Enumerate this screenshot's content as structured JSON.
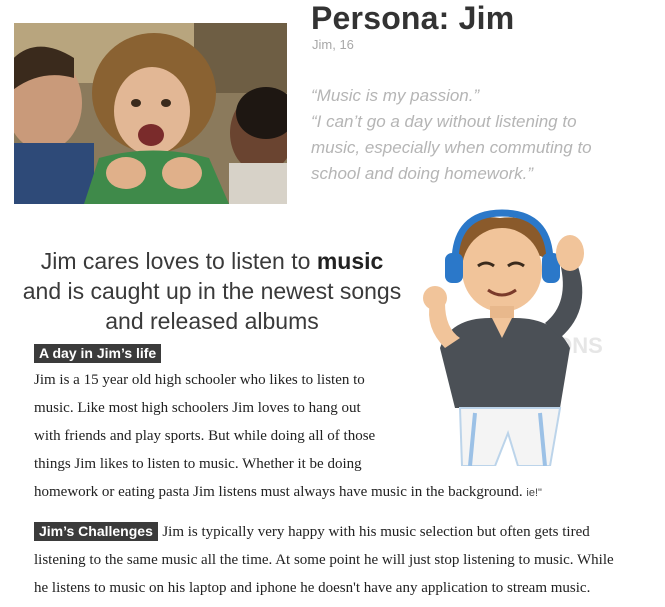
{
  "header": {
    "title": "Persona: Jim",
    "subtitle": "Jim, 16"
  },
  "quotes": [
    "“Music is my passion.”",
    "“I can’t go a day without listening to",
    "music, especially when commuting to",
    "school and doing homework.”"
  ],
  "headline": {
    "before": "Jim cares loves to listen to ",
    "bold": "music",
    "after": " and is caught up in the newest songs and released albums"
  },
  "day": {
    "label": "A day in Jim’s life",
    "lines": [
      "Jim is a 15 year old high schooler who likes to listen to",
      "music. Like most high schoolers Jim loves to hang out",
      "with friends and play sports. But while doing all of those",
      "things Jim likes to listen to music. Whether it be doing",
      "homework or eating pasta Jim listens must always have music in the background."
    ],
    "trailing": "ie!\""
  },
  "challenges": {
    "label": "Jim’s Challenges",
    "first_line": "Jim is typically very happy with his music selection but often gets tired",
    "lines": [
      "listening to the same music all the time. At some point he will just stop listening to music. While",
      "he listens to music on his laptop and iphone he doesn't have any application to stream music."
    ]
  },
  "watermark": "TOONS",
  "colors": {
    "badge_bg": "#3b3b3b",
    "quote": "#b5b5b5",
    "title": "#333333",
    "headphones": "#2b78c9"
  }
}
